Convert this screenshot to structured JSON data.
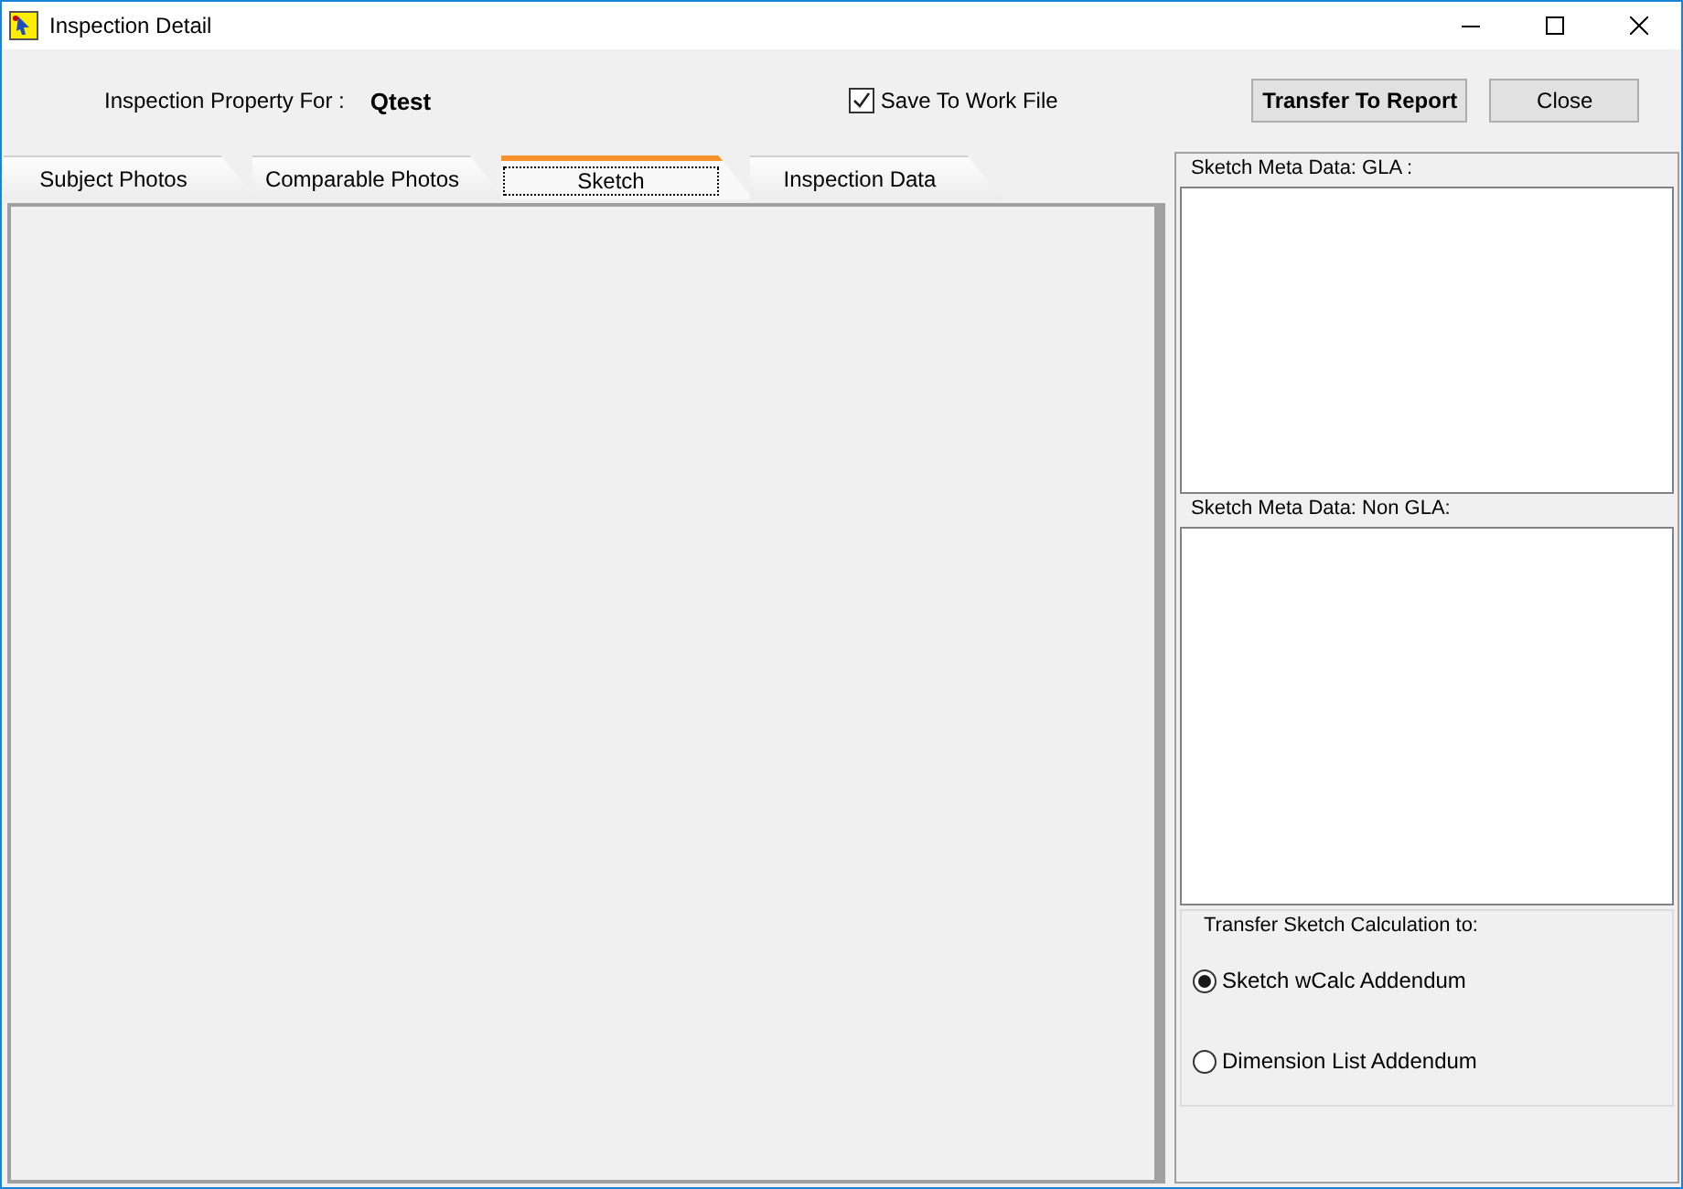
{
  "window": {
    "title": "Inspection Detail"
  },
  "header": {
    "property_label": "Inspection Property For :",
    "property_value": "Qtest",
    "save_checkbox": {
      "label": "Save To Work File",
      "checked": true
    },
    "buttons": [
      {
        "label": "Transfer To Report",
        "kind": "bold"
      },
      {
        "label": "Close",
        "kind": "plain"
      }
    ]
  },
  "tabs": [
    {
      "label": "Subject Photos",
      "selected": false
    },
    {
      "label": "Comparable Photos",
      "selected": false
    },
    {
      "label": "Sketch",
      "selected": true
    },
    {
      "label": "Inspection Data",
      "selected": false
    }
  ],
  "side_panel": {
    "gla_label": "Sketch Meta Data: GLA :",
    "non_gla_label": "Sketch Meta Data: Non GLA:",
    "transfer_group": {
      "title": "Transfer Sketch Calculation to:",
      "options": [
        {
          "label": "Sketch wCalc Addendum",
          "selected": true
        },
        {
          "label": "Dimension List Addendum",
          "selected": false
        }
      ]
    }
  }
}
